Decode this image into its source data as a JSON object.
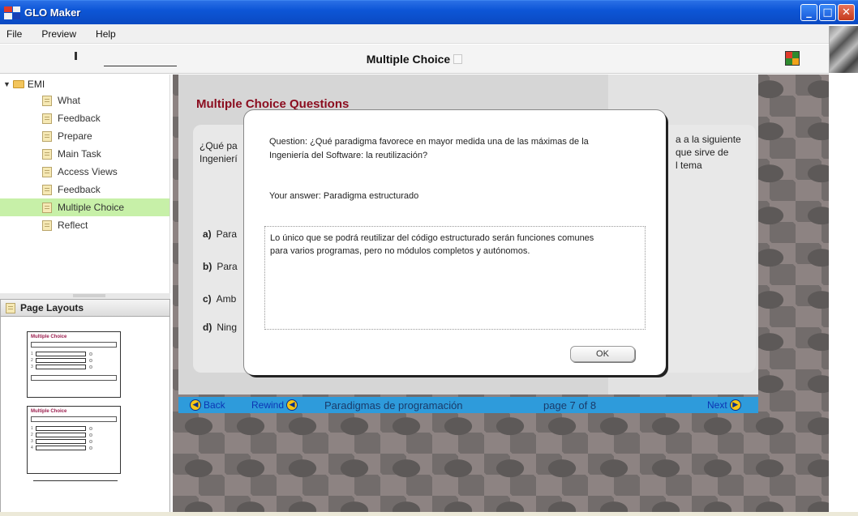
{
  "window": {
    "title": "GLO Maker",
    "buttons": {
      "minimize": "_",
      "maximize": "□",
      "close": "✕"
    }
  },
  "menu": [
    "File",
    "Preview",
    "Help"
  ],
  "toolbar": {
    "page_title": "Multiple Choice"
  },
  "tree": {
    "root": "EMI",
    "items": [
      {
        "label": "What"
      },
      {
        "label": "Feedback"
      },
      {
        "label": "Prepare"
      },
      {
        "label": "Main Task"
      },
      {
        "label": "Access Views"
      },
      {
        "label": "Feedback"
      },
      {
        "label": "Multiple Choice",
        "selected": true
      },
      {
        "label": "Reflect"
      }
    ]
  },
  "layouts": {
    "title": "Page Layouts",
    "thumbs": [
      {
        "title": "Multiple Choice",
        "rows": [
          "1",
          "2",
          "3"
        ]
      },
      {
        "title": "Multiple Choice",
        "rows": [
          "1",
          "2",
          "3",
          "4"
        ]
      }
    ]
  },
  "content": {
    "heading": "Multiple Choice Questions",
    "question_left_1": "¿Qué pa",
    "question_left_2": "Ingenierí",
    "question_right_1": "a a la siguiente",
    "question_right_2": "que sirve de",
    "question_right_3": "l tema",
    "options": [
      {
        "letter": "a)",
        "text": "Para"
      },
      {
        "letter": "b)",
        "text": "Para"
      },
      {
        "letter": "c)",
        "text": "Amb"
      },
      {
        "letter": "d)",
        "text": "Ning"
      }
    ]
  },
  "nav": {
    "back": "Back",
    "rewind": "Rewind",
    "topic": "Paradigmas de programación",
    "page": "page 7 of 8",
    "next": "Next"
  },
  "modal": {
    "question_line1": "Question: ¿Qué paradigma favorece en mayor medida una de las máximas de la",
    "question_line2": "Ingeniería del Software: la reutilización?",
    "answer": "Your answer: Paradigma estructurado",
    "feedback_line1": "Lo único que se podrá reutilizar del código estructurado serán funciones comunes",
    "feedback_line2": "para varios programas, pero no módulos completos y autónomos.",
    "ok": "OK"
  },
  "colors": {
    "titlebar": "#0d56d6",
    "selected_item": "#c7f0a8",
    "heading": "#8b0d1f",
    "navbar": "#2e9bdb",
    "nav_icon": "#f5c515"
  }
}
